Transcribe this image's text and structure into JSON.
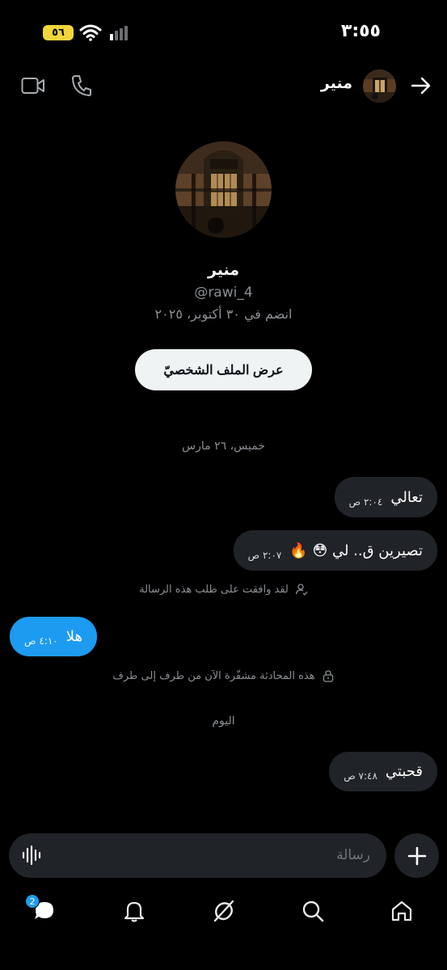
{
  "status_bar": {
    "time": "٣:٥٥",
    "battery": "٥٦"
  },
  "header": {
    "contact_name": "منير"
  },
  "profile": {
    "name": "منير",
    "handle": "@rawi_4",
    "joined": "انضم في ٣٠ أكتوبر، ٢٠٢٥",
    "view_profile_label": "عرض الملف الشخصيّ"
  },
  "conversation": {
    "date_1": "خميس، ٢٦ مارس",
    "messages_1": [
      {
        "text": "تعالي",
        "time": "٢:٠٤ ص"
      },
      {
        "text": "تصيرين ق.. لي 😳 🔥",
        "time": "٢:٠٧ ص"
      }
    ],
    "accepted_note": "لقد وافقت على طلب هذه الرسالة",
    "outgoing_1": {
      "text": "هلا",
      "time": "٤:١٠ ص"
    },
    "encryption_note": "هذه المحادثة مشفّرة الآن من طرف إلى طرف",
    "date_2": "اليوم",
    "messages_2": [
      {
        "text": "قحبتي",
        "time": "٧:٤٨ ص"
      }
    ]
  },
  "composer": {
    "placeholder": "رسالة"
  },
  "nav": {
    "messages_badge": "2"
  },
  "colors": {
    "accent": "#1d9bf0",
    "background": "#000000",
    "bubble": "#202327",
    "battery": "#f0d63b"
  }
}
